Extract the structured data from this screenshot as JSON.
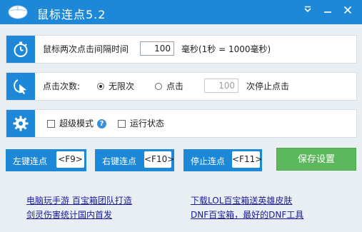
{
  "app": {
    "title": "鼠标连点5.2",
    "menu_icon": "chevron-down-icon",
    "minimize_icon": "minimize-icon",
    "close_icon": "close-icon"
  },
  "interval": {
    "icon": "stopwatch-icon",
    "label": "鼠标两次点击间隔时间",
    "value": "100",
    "unit_label": "毫秒(1秒 = 1000毫秒)"
  },
  "clicks": {
    "icon": "cursor-click-icon",
    "label": "点击次数:",
    "unlimited_label": "无限次",
    "unlimited_selected": true,
    "count_label": "点击",
    "count_value": "100",
    "stop_label": "次停止点击"
  },
  "options": {
    "icon": "gear-icon",
    "super_mode_label": "超级模式",
    "super_mode_checked": false,
    "help_icon": "help-icon",
    "running_label": "运行状态",
    "running_checked": false
  },
  "buttons": {
    "left_label": "左键连点",
    "left_key": "<F9>",
    "right_label": "右键连点",
    "right_key": "<F10>",
    "stop_label": "停止连点",
    "stop_key": "<F11>",
    "save_label": "保存设置"
  },
  "links": [
    "电脑玩手游 百宝箱团队打造",
    "剑灵伤害统计国内首发",
    "下载LOL百宝箱送英雄皮肤",
    "DNF百宝箱，最好的DNF工具"
  ],
  "colors": {
    "accent": "#1e88d8",
    "save": "#5cb85c",
    "background": "#e9eef3"
  }
}
